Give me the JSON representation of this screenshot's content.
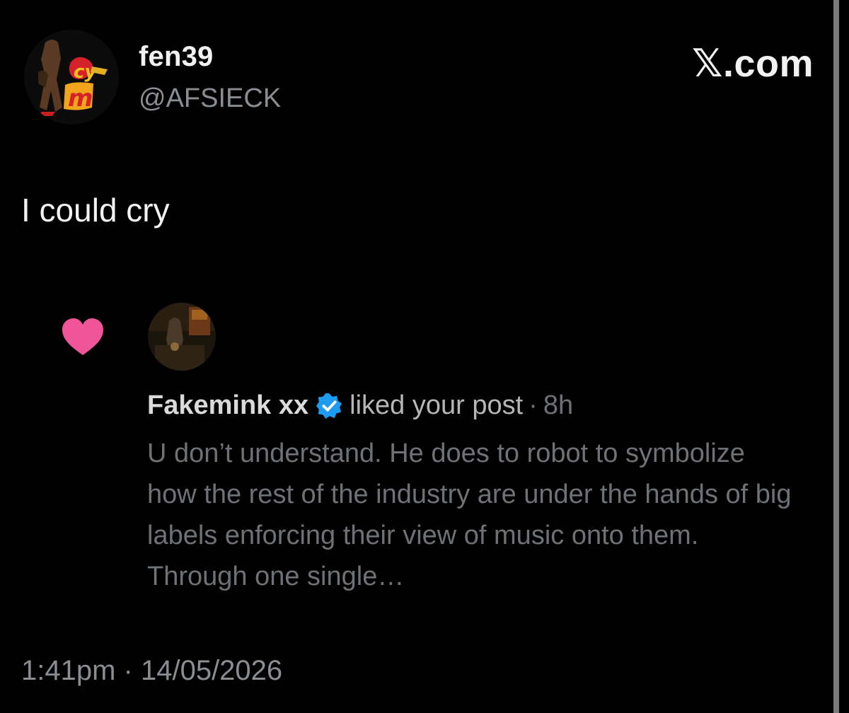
{
  "post": {
    "author": {
      "display_name": "fen39",
      "handle": "@AFSIECK",
      "avatar_icon": "profile-photo"
    },
    "brand": "𝕏.com",
    "text": "I could cry",
    "timestamp": "1:41pm · 14/05/2026"
  },
  "notification": {
    "icon": "heart-icon",
    "heart_color": "#f0559a",
    "liker_name": "Fakemink xx",
    "verified_color": "#1d9bf0",
    "action": "liked your post",
    "separator": "·",
    "time_ago": "8h",
    "excerpt": "U don’t understand. He does to robot to symbolize how the rest of the industry are under the hands of big labels enforcing their view of music onto them. Through one single…"
  }
}
